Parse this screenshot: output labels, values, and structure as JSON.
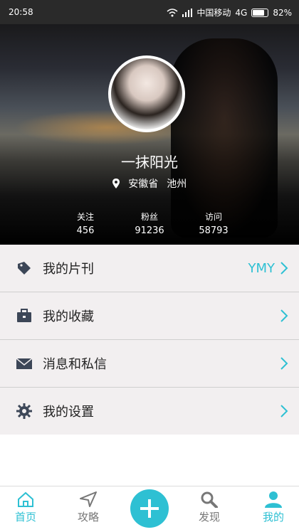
{
  "status_bar": {
    "time": "20:58",
    "carrier": "中国移动",
    "network": "4G",
    "battery": "82%"
  },
  "profile": {
    "name": "一抹阳光",
    "province": "安徽省",
    "city": "池州"
  },
  "stats": [
    {
      "label": "关注",
      "value": "456"
    },
    {
      "label": "粉丝",
      "value": "91236"
    },
    {
      "label": "访问",
      "value": "58793"
    }
  ],
  "menu": [
    {
      "label": "我的片刊",
      "extra": "YMY",
      "icon": "tag-icon"
    },
    {
      "label": "我的收藏",
      "icon": "briefcase-icon"
    },
    {
      "label": "消息和私信",
      "icon": "envelope-icon"
    },
    {
      "label": "我的设置",
      "icon": "gear-icon"
    }
  ],
  "tabs": [
    {
      "label": "首页",
      "icon": "home-icon",
      "active": true
    },
    {
      "label": "攻略",
      "icon": "navigation-icon"
    },
    {
      "label": "发现",
      "icon": "search-icon"
    },
    {
      "label": "我的",
      "icon": "user-icon"
    }
  ],
  "colors": {
    "accent": "#2ec0d3",
    "menu_bg": "#f2eff0",
    "status_bar": "#2a2a2a"
  }
}
